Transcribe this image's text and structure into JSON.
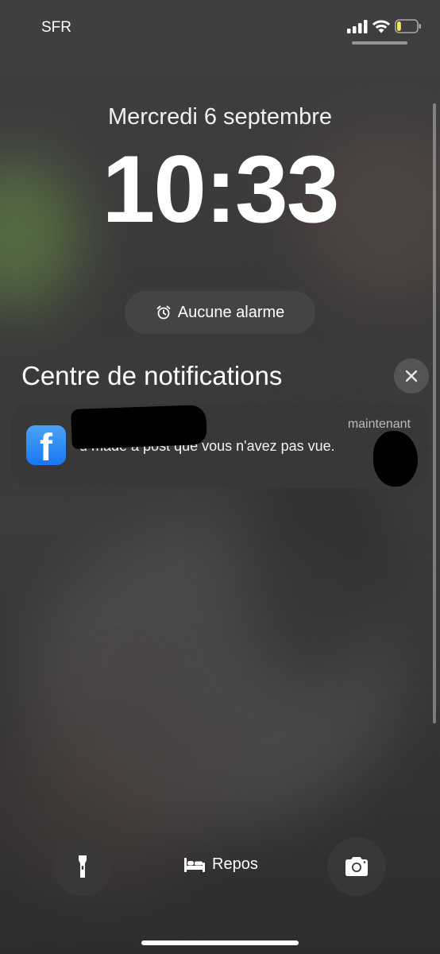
{
  "status_bar": {
    "carrier": "SFR",
    "signal_icon": "cellular-signal-icon",
    "wifi_icon": "wifi-icon",
    "battery_icon": "battery-icon",
    "battery_level": 0.2,
    "battery_color": "#f5e663"
  },
  "lock_screen": {
    "date": "Mercredi 6 septembre",
    "time": "10:33",
    "alarm": {
      "icon": "alarm-clock-icon",
      "label": "Aucune alarme"
    }
  },
  "notification_center": {
    "title": "Centre de notifications",
    "close_icon": "close-icon",
    "notifications": [
      {
        "app_icon": "facebook-icon",
        "app_icon_color": "#1877f2",
        "time": "maintenant",
        "body": "u made a post que vous n'avez pas vue.",
        "redacted": true
      }
    ]
  },
  "bottom": {
    "flashlight_icon": "flashlight-icon",
    "focus": {
      "icon": "bed-icon",
      "label": "Repos"
    },
    "camera_icon": "camera-icon"
  }
}
